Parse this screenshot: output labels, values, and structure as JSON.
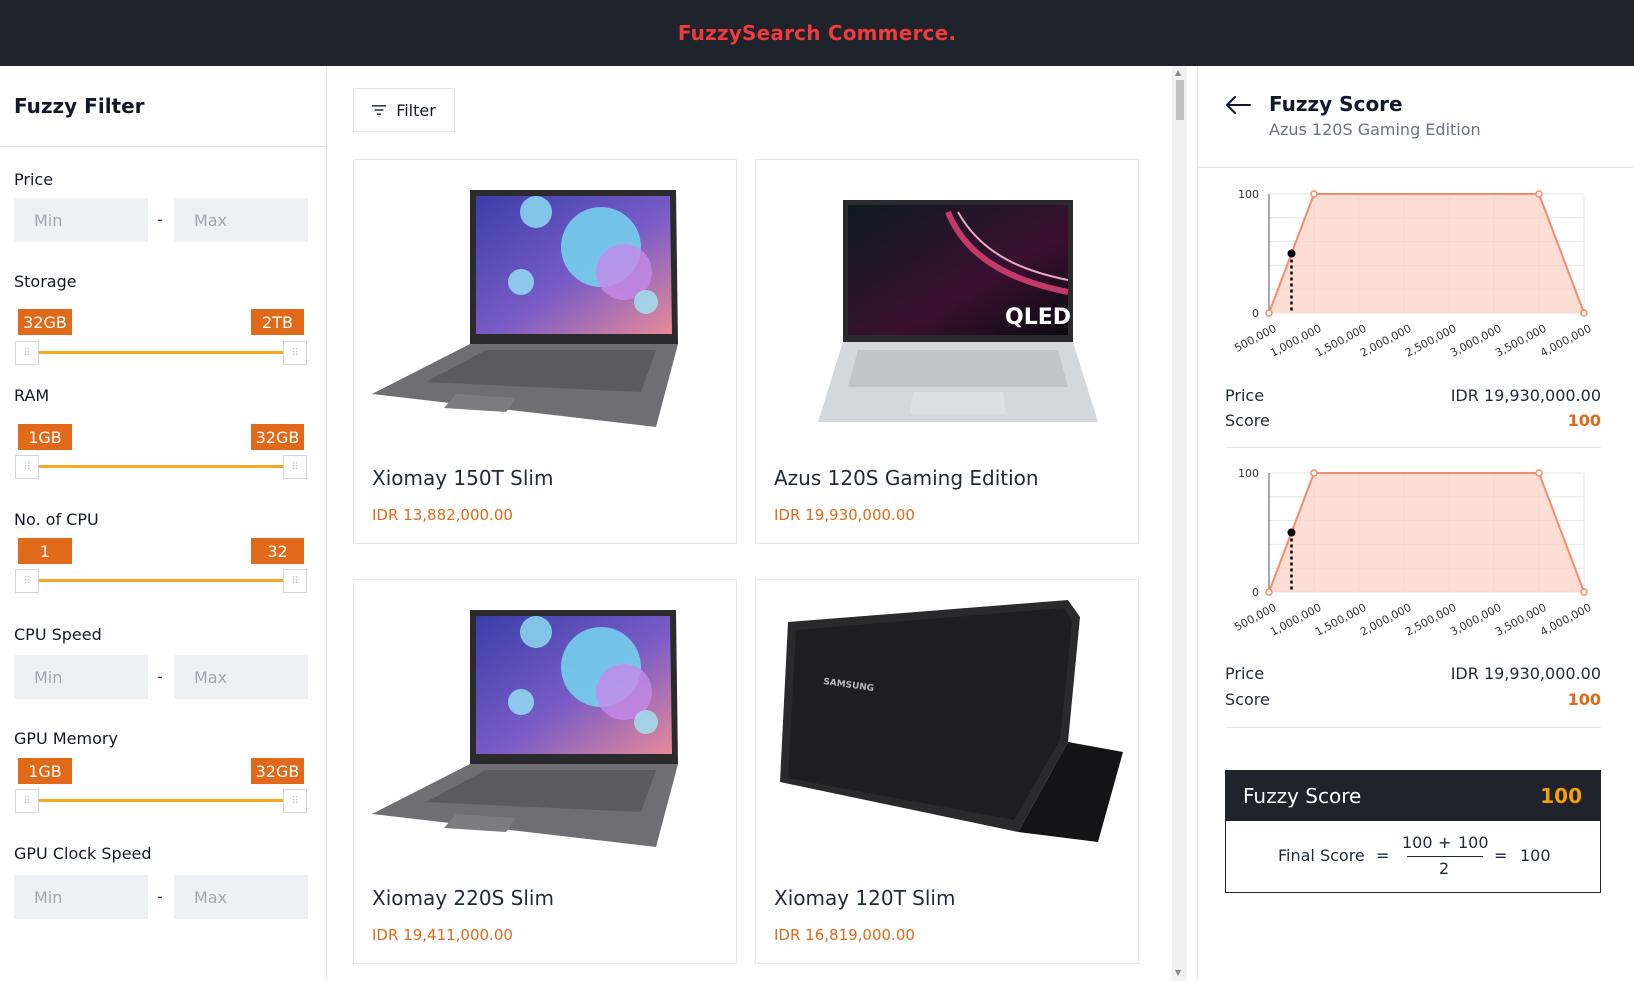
{
  "header": {
    "brand": "FuzzySearch Commerce."
  },
  "sidebar": {
    "title": "Fuzzy Filter",
    "price": {
      "label": "Price",
      "min_placeholder": "Min",
      "max_placeholder": "Max",
      "separator": "-"
    },
    "storage": {
      "label": "Storage",
      "min_tag": "32GB",
      "max_tag": "2TB"
    },
    "ram": {
      "label": "RAM",
      "min_tag": "1GB",
      "max_tag": "32GB"
    },
    "cpu_count": {
      "label": "No. of CPU",
      "min_tag": "1",
      "max_tag": "32"
    },
    "cpu_speed": {
      "label": "CPU Speed",
      "min_placeholder": "Min",
      "max_placeholder": "Max",
      "separator": "-"
    },
    "gpu_memory": {
      "label": "GPU Memory",
      "min_tag": "1GB",
      "max_tag": "32GB"
    },
    "gpu_clock": {
      "label": "GPU Clock Speed",
      "min_placeholder": "Min",
      "max_placeholder": "Max",
      "separator": "-"
    }
  },
  "main": {
    "filter_button": "Filter",
    "products": [
      {
        "name": "Xiomay 150T Slim",
        "price": "IDR 13,882,000.00",
        "image": "laptop-galaxy-book"
      },
      {
        "name": "Azus 120S Gaming Edition",
        "price": "IDR 19,930,000.00",
        "image": "laptop-qled"
      },
      {
        "name": "Xiomay 220S Slim",
        "price": "IDR 19,411,000.00",
        "image": "laptop-galaxy-book"
      },
      {
        "name": "Xiomay 120T Slim",
        "price": "IDR 16,819,000.00",
        "image": "laptop-black-samsung"
      }
    ]
  },
  "panel": {
    "title": "Fuzzy Score",
    "subtitle": "Azus 120S Gaming Edition",
    "blocks": [
      {
        "price_label": "Price",
        "price_value": "IDR 19,930,000.00",
        "score_label": "Score",
        "score_value": "100"
      },
      {
        "price_label": "Price",
        "price_value": "IDR 19,930,000.00",
        "score_label": "Score",
        "score_value": "100"
      }
    ],
    "final": {
      "title": "Fuzzy Score",
      "value": "100",
      "label": "Final Score",
      "eq1": "=",
      "num_a": "100",
      "plus": "+",
      "num_b": "100",
      "denominator": "2",
      "eq2": "=",
      "result": "100"
    }
  },
  "chart_data": [
    {
      "type": "area",
      "x": [
        500000,
        1000000,
        3500000,
        4000000
      ],
      "values": [
        0,
        100,
        100,
        0
      ],
      "marker": {
        "x": 750000,
        "y": 50
      },
      "x_ticks": [
        "500,000",
        "1,000,000",
        "1,500,000",
        "2,000,000",
        "2,500,000",
        "3,000,000",
        "3,500,000",
        "4,000,000"
      ],
      "y_ticks": [
        "0",
        "100"
      ],
      "xlim": [
        500000,
        4000000
      ],
      "ylim": [
        0,
        100
      ],
      "grid": true,
      "colors": {
        "line": "#f58b6e",
        "fill": "#fcd3c6",
        "marker": "#000000"
      }
    },
    {
      "type": "area",
      "x": [
        500000,
        1000000,
        3500000,
        4000000
      ],
      "values": [
        0,
        100,
        100,
        0
      ],
      "marker": {
        "x": 750000,
        "y": 50
      },
      "x_ticks": [
        "500,000",
        "1,000,000",
        "1,500,000",
        "2,000,000",
        "2,500,000",
        "3,000,000",
        "3,500,000",
        "4,000,000"
      ],
      "y_ticks": [
        "0",
        "100"
      ],
      "xlim": [
        500000,
        4000000
      ],
      "ylim": [
        0,
        100
      ],
      "grid": true,
      "colors": {
        "line": "#f58b6e",
        "fill": "#fcd3c6",
        "marker": "#000000"
      }
    }
  ]
}
